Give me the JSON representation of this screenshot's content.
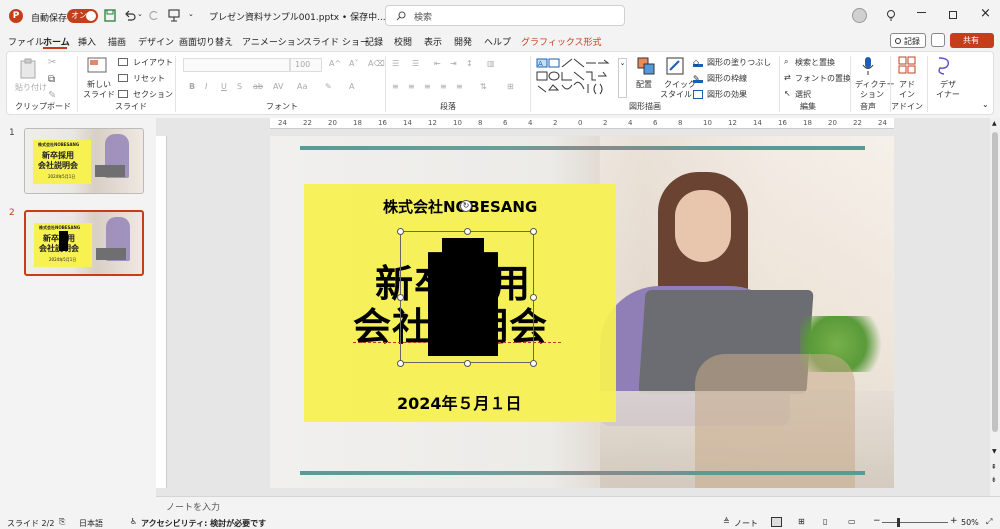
{
  "titlebar": {
    "autosave_label": "自動保存",
    "autosave_state": "オン",
    "filename": "プレゼン資料サンプル001.pptx • 保存中...",
    "search_placeholder": "検索"
  },
  "menu": [
    "ファイル",
    "ホーム",
    "挿入",
    "描画",
    "デザイン",
    "画面切り替え",
    "アニメーション",
    "スライド ショー",
    "記録",
    "校閲",
    "表示",
    "開発",
    "ヘルプ",
    "グラフィックス形式"
  ],
  "menu_active": "ホーム",
  "record_button": "記録",
  "share_button": "共有",
  "ribbon": {
    "clipboard": {
      "paste": "貼り付け",
      "label": "クリップボード"
    },
    "slides": {
      "new_slide": "新しい",
      "new_slide2": "スライド",
      "layout": "レイアウト",
      "reset": "リセット",
      "section": "セクション",
      "label": "スライド"
    },
    "font": {
      "size": "100",
      "label": "フォント"
    },
    "paragraph": {
      "label": "段落"
    },
    "drawing": {
      "arrange": "配置",
      "quick_styles": "クイック",
      "quick_styles2": "スタイル",
      "fill": "図形の塗りつぶし",
      "outline": "図形の枠線",
      "effects": "図形の効果",
      "label": "図形描画"
    },
    "editing": {
      "find": "検索と置換",
      "replace_font": "フォントの置換",
      "select": "選択",
      "label": "編集"
    },
    "voice": {
      "dictate": "ディクテー",
      "dictate2": "ション",
      "label": "音声"
    },
    "addins": {
      "addin": "アド",
      "addin2": "イン",
      "label": "アドイン"
    },
    "designer": {
      "label": "デザ",
      "label2": "イナー"
    }
  },
  "ruler": [
    "24",
    "22",
    "20",
    "18",
    "16",
    "14",
    "12",
    "10",
    "8",
    "6",
    "4",
    "2",
    "0",
    "2",
    "4",
    "6",
    "8",
    "10",
    "12",
    "14",
    "16",
    "18",
    "20",
    "22",
    "24"
  ],
  "thumbnails": [
    {
      "num": "1",
      "company": "株式会社NOBESANG",
      "title1": "新卒採用",
      "title2": "会社説明会",
      "date": "2024年5月1日"
    },
    {
      "num": "2",
      "company": "株式会社NOBESANG",
      "title1": "新卒採用",
      "title2": "会社説明会",
      "date": "2024年5月1日"
    }
  ],
  "slide": {
    "company": "株式会社NOBESANG",
    "title1": "新卒採用",
    "title2": "会社説明会",
    "date": "2024年５月１日"
  },
  "notes_placeholder": "ノートを入力",
  "status": {
    "slide_count": "スライド 2/2",
    "language": "日本語",
    "accessibility": "アクセシビリティ: 検討が必要です",
    "notes": "ノート",
    "zoom": "50%"
  },
  "colors": {
    "accent": "#c43e1c",
    "slide_yellow": "#f7f152",
    "slide_teal": "#5a9a96"
  }
}
